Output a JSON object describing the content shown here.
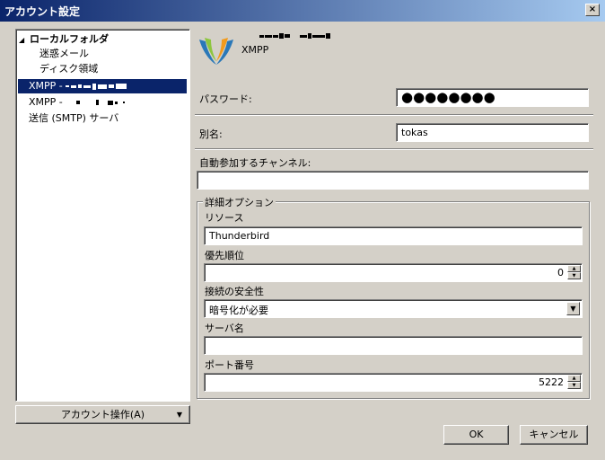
{
  "window": {
    "title": "アカウント設定",
    "close_glyph": "×"
  },
  "tree": {
    "root_label": "ローカルフォルダ",
    "root_expander": "◢",
    "children": [
      "迷惑メール",
      "ディスク領域"
    ],
    "accounts": [
      {
        "label": "XMPP - ",
        "selected": true
      },
      {
        "label": "XMPP - ",
        "selected": false
      },
      {
        "label": "送信 (SMTP) サーバ",
        "selected": false
      }
    ]
  },
  "account_actions": {
    "label": "アカウント操作(A)",
    "arrow": "▼"
  },
  "header": {
    "protocol": "XMPP",
    "logo_icon": "xmpp-logo-icon"
  },
  "fields": {
    "password_label": "パスワード:",
    "password_value": "●●●●●●●●",
    "alias_label": "別名:",
    "alias_value": "tokas",
    "autojoin_label": "自動参加するチャンネル:",
    "autojoin_value": ""
  },
  "advanced": {
    "title": "詳細オプション",
    "resource_label": "リソース",
    "resource_value": "Thunderbird",
    "priority_label": "優先順位",
    "priority_value": "0",
    "security_label": "接続の安全性",
    "security_value": "暗号化が必要",
    "server_label": "サーバ名",
    "server_value": "",
    "port_label": "ポート番号",
    "port_value": "5222"
  },
  "buttons": {
    "ok": "OK",
    "cancel": "キャンセル"
  },
  "colors": {
    "selection": "#0a246a",
    "face": "#d4d0c8"
  }
}
